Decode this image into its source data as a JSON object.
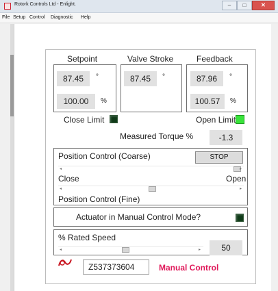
{
  "window": {
    "title": "Rotork Controls Ltd - Enlight."
  },
  "menu": [
    "File",
    "Setup",
    "Control",
    "Diagnostic",
    "Help"
  ],
  "setpoint": {
    "label": "Setpoint",
    "value": "87.45",
    "unit": "°",
    "percent": "100.00",
    "percent_unit": "%"
  },
  "valve_stroke": {
    "label": "Valve Stroke",
    "value": "87.45",
    "unit": "°"
  },
  "feedback": {
    "label": "Feedback",
    "value": "87.96",
    "unit": "°",
    "percent": "100.57",
    "percent_unit": "%"
  },
  "limits": {
    "close_label": "Close Limit",
    "close_state": "off",
    "open_label": "Open Limit",
    "open_state": "on",
    "colors": {
      "on": "#39e33b",
      "off": "#0f3a18"
    }
  },
  "torque": {
    "label": "Measured Torque %",
    "value": "-1.3"
  },
  "position_control": {
    "coarse_label": "Position Control (Coarse)",
    "stop_label": "STOP",
    "close_label": "Close",
    "open_label": "Open",
    "fine_label": "Position Control (Fine)",
    "coarse_level": 1.0,
    "fine_level": 0.5
  },
  "manual_mode": {
    "question": "Actuator in Manual Control Mode?",
    "state": "off"
  },
  "speed": {
    "label": "% Rated Speed",
    "value": "50",
    "level": 0.45
  },
  "footer": {
    "serial": "Z537373604",
    "mode_text": "Manual Control",
    "mode_color": "#e0195a",
    "brand_icon": "rotork-logo-icon"
  }
}
